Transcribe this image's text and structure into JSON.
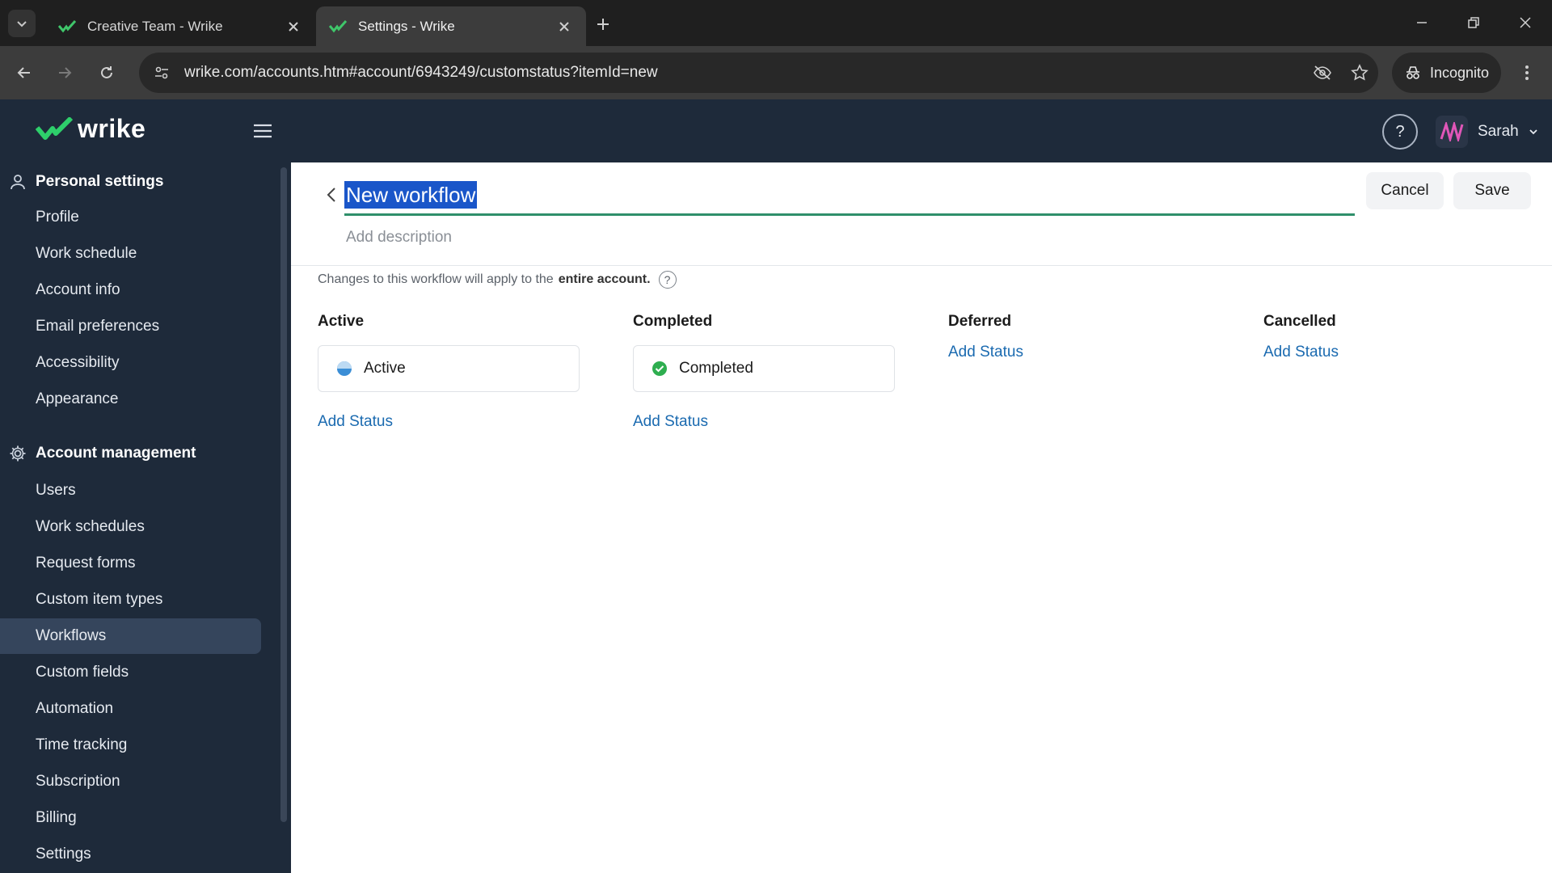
{
  "browser": {
    "tabs": [
      {
        "title": "Creative Team - Wrike",
        "active": false
      },
      {
        "title": "Settings - Wrike",
        "active": true
      }
    ],
    "url": "wrike.com/accounts.htm#account/6943249/customstatus?itemId=new",
    "incognito_label": "Incognito"
  },
  "app": {
    "logo_text": "wrike",
    "user_name": "Sarah",
    "help_label": "?"
  },
  "sidebar": {
    "personal_heading": "Personal settings",
    "personal_items": [
      "Profile",
      "Work schedule",
      "Account info",
      "Email preferences",
      "Accessibility",
      "Appearance"
    ],
    "account_heading": "Account management",
    "account_items": [
      "Users",
      "Work schedules",
      "Request forms",
      "Custom item types",
      "Workflows",
      "Custom fields",
      "Automation",
      "Time tracking",
      "Subscription",
      "Billing",
      "Settings"
    ],
    "selected": "Workflows"
  },
  "editor": {
    "title": "New workflow",
    "description_placeholder": "Add description",
    "cancel_label": "Cancel",
    "save_label": "Save"
  },
  "notice": {
    "prefix": "Changes to this workflow will apply to the",
    "emphasis": "entire account."
  },
  "columns": [
    {
      "heading": "Active",
      "status": "Active",
      "add_label": "Add Status"
    },
    {
      "heading": "Completed",
      "status": "Completed",
      "add_label": "Add Status"
    },
    {
      "heading": "Deferred",
      "add_label": "Add Status"
    },
    {
      "heading": "Cancelled",
      "add_label": "Add Status"
    }
  ],
  "colors": {
    "header_bg": "#1e2a3a",
    "selected_nav": "#35455c",
    "accent_green": "#2f8f6b",
    "link_blue": "#1a6ab0",
    "selection_blue": "#1a56c9",
    "active_status": "#3b8ed6",
    "completed_status": "#2eae4f"
  }
}
